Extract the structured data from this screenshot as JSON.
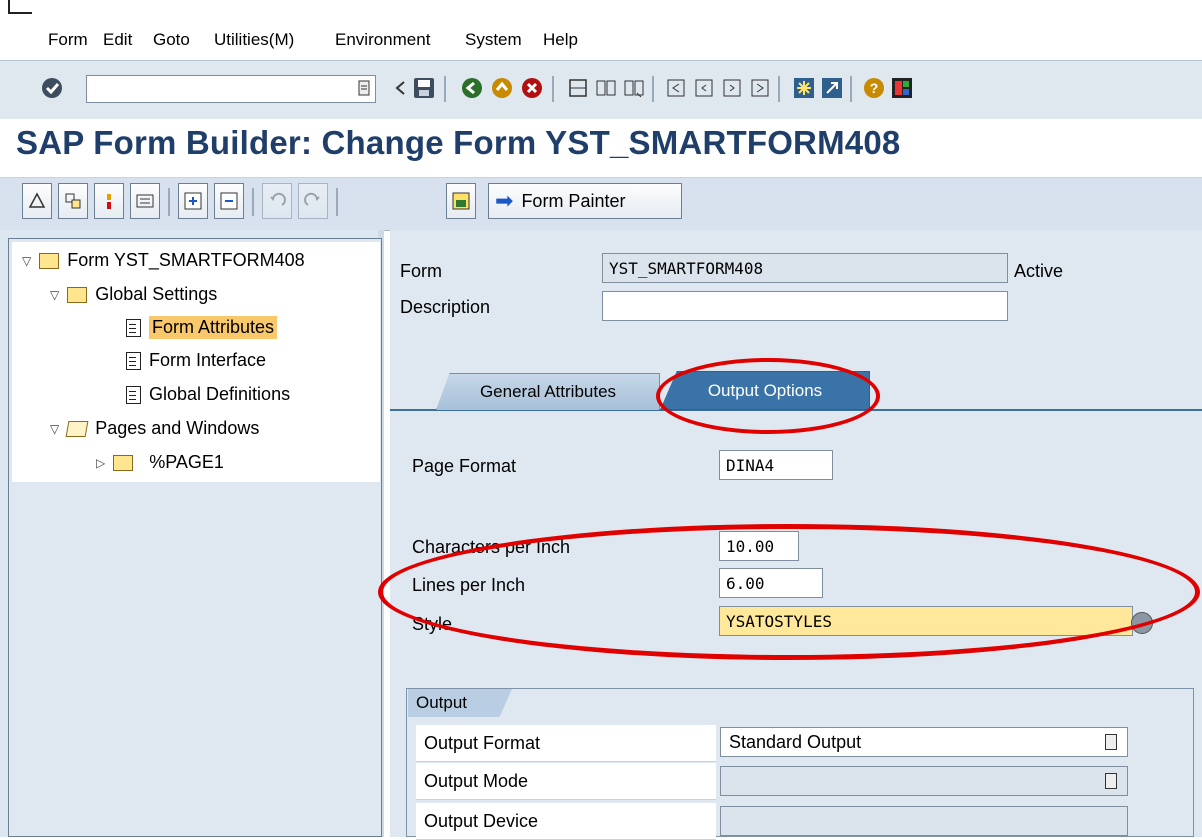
{
  "menu": [
    "Form",
    "Edit",
    "Goto",
    "Utilities(M)",
    "Environment",
    "System",
    "Help"
  ],
  "title": "SAP Form Builder: Change Form YST_SMARTFORM408",
  "app_toolbar": {
    "form_painter_label": "Form Painter"
  },
  "tree": {
    "root": "Form YST_SMARTFORM408",
    "global_settings": "Global Settings",
    "form_attributes": "Form Attributes",
    "form_interface": "Form Interface",
    "global_definitions": "Global Definitions",
    "pages_windows": "Pages and Windows",
    "page1": "%PAGE1"
  },
  "header": {
    "form_label": "Form",
    "form_value": "YST_SMARTFORM408",
    "status": "Active",
    "description_label": "Description",
    "description_value": ""
  },
  "tabs": {
    "general": "General Attributes",
    "output": "Output Options"
  },
  "output_options": {
    "page_format_label": "Page Format",
    "page_format_value": "DINA4",
    "cpi_label": "Characters per Inch",
    "cpi_value": "10.00",
    "lpi_label": "Lines per Inch",
    "lpi_value": "6.00",
    "style_label": "Style",
    "style_value": "YSATOSTYLES"
  },
  "output_group": {
    "title": "Output",
    "format_label": "Output Format",
    "format_value": "Standard Output",
    "mode_label": "Output Mode",
    "mode_value": "",
    "device_label": "Output Device",
    "device_value": ""
  },
  "colors": {
    "title": "#1f3f6a",
    "active_tab": "#3a73a7",
    "highlight": "#ffe89a",
    "annotation": "#e00000"
  }
}
